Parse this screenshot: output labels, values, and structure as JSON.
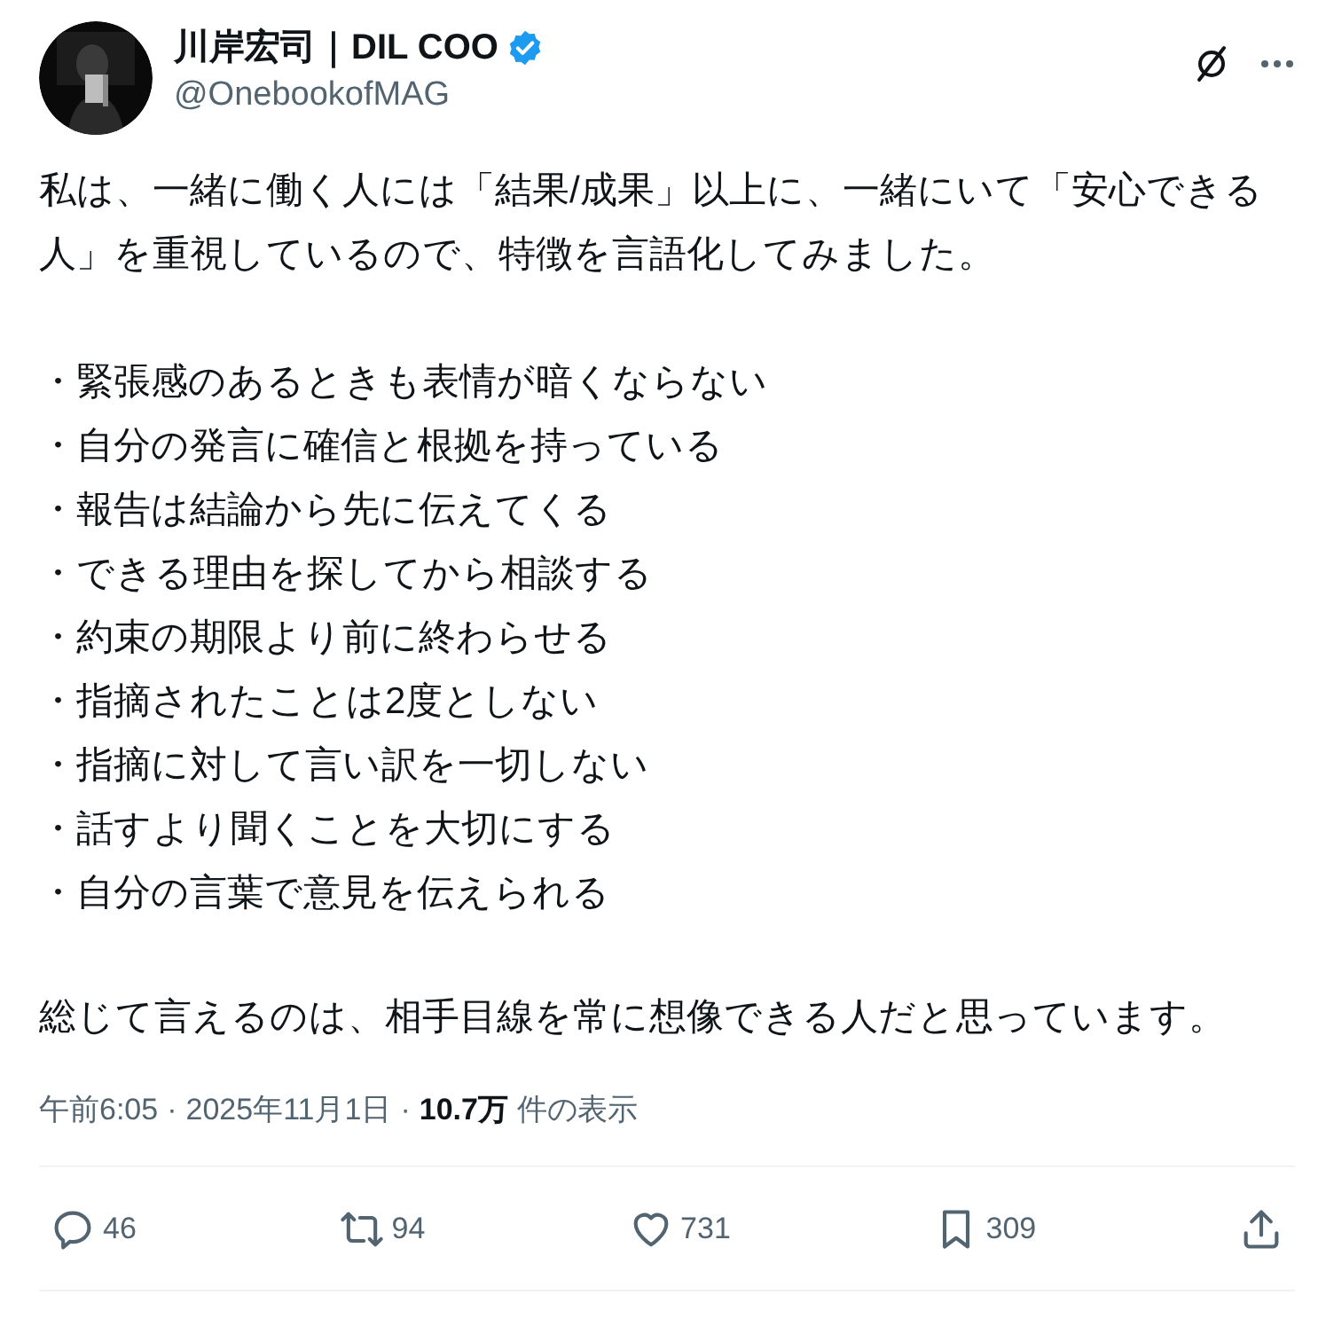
{
  "author": {
    "name": "川岸宏司｜DIL COO",
    "verified": true,
    "handle": "@OnebookofMAG"
  },
  "post": {
    "intro": "私は、一緒に働く人には「結果/成果」以上に、一緒にいて「安心できる人」を重視しているので、特徴を言語化してみました。",
    "bullets": [
      "・緊張感のあるときも表情が暗くならない",
      "・自分の発言に確信と根拠を持っている",
      "・報告は結論から先に伝えてくる",
      "・できる理由を探してから相談する",
      "・約束の期限より前に終わらせる",
      "・指摘されたことは2度としない",
      "・指摘に対して言い訳を一切しない",
      "・話すより聞くことを大切にする",
      "・自分の言葉で意見を伝えられる"
    ],
    "summary": "総じて言えるのは、相手目線を常に想像できる人だと思っています。"
  },
  "meta": {
    "time": "午前6:05",
    "separator": "·",
    "date": "2025年11月1日",
    "views": "10.7万",
    "views_label": "件の表示"
  },
  "actions": [
    {
      "kind": "reply",
      "count": "46"
    },
    {
      "kind": "repost",
      "count": "94"
    },
    {
      "kind": "like",
      "count": "731"
    },
    {
      "kind": "bookmark",
      "count": "309"
    },
    {
      "kind": "share"
    }
  ]
}
